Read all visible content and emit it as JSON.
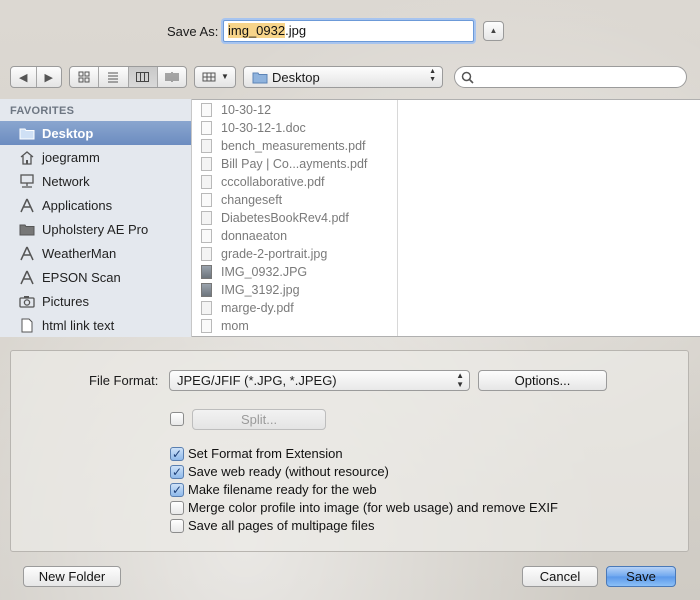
{
  "save_as": {
    "label": "Save As:",
    "filename_base": "img_0932",
    "filename_ext": ".jpg"
  },
  "toolbar": {
    "location": "Desktop",
    "search_placeholder": ""
  },
  "sidebar": {
    "header": "FAVORITES",
    "items": [
      {
        "label": "Desktop",
        "icon": "desktop-folder-icon",
        "selected": true
      },
      {
        "label": "joegramm",
        "icon": "home-icon"
      },
      {
        "label": "Network",
        "icon": "network-icon"
      },
      {
        "label": "Applications",
        "icon": "applications-icon"
      },
      {
        "label": "Upholstery AE Pro",
        "icon": "folder-icon"
      },
      {
        "label": "WeatherMan",
        "icon": "applications-icon"
      },
      {
        "label": "EPSON Scan",
        "icon": "applications-icon"
      },
      {
        "label": "Pictures",
        "icon": "camera-icon"
      },
      {
        "label": "html link text",
        "icon": "document-icon"
      }
    ]
  },
  "files": [
    {
      "name": "10-30-12",
      "type": "doc"
    },
    {
      "name": "10-30-12-1.doc",
      "type": "doc"
    },
    {
      "name": "bench_measurements.pdf",
      "type": "pdf"
    },
    {
      "name": "Bill Pay | Co...ayments.pdf",
      "type": "pdf"
    },
    {
      "name": "cccollaborative.pdf",
      "type": "pdf"
    },
    {
      "name": "changeseft",
      "type": "doc"
    },
    {
      "name": "DiabetesBookRev4.pdf",
      "type": "pdf"
    },
    {
      "name": "donnaeaton",
      "type": "doc"
    },
    {
      "name": "grade-2-portrait.jpg",
      "type": "pdf"
    },
    {
      "name": "IMG_0932.JPG",
      "type": "img"
    },
    {
      "name": "IMG_3192.jpg",
      "type": "img"
    },
    {
      "name": "marge-dy.pdf",
      "type": "pdf"
    },
    {
      "name": "mom",
      "type": "doc"
    }
  ],
  "options": {
    "file_format_label": "File Format:",
    "file_format_value": "JPEG/JFIF (*.JPG, *.JPEG)",
    "options_button": "Options...",
    "split_button": "Split...",
    "checkboxes": [
      {
        "label": "Set Format from Extension",
        "checked": true
      },
      {
        "label": "Save web ready (without resource)",
        "checked": true
      },
      {
        "label": "Make filename ready for the web",
        "checked": true
      },
      {
        "label": "Merge color profile into image (for web usage) and remove EXIF",
        "checked": false
      },
      {
        "label": "Save all pages of multipage files",
        "checked": false
      }
    ]
  },
  "footer": {
    "new_folder": "New Folder",
    "cancel": "Cancel",
    "save": "Save"
  },
  "colors": {
    "selection_blue": "#6c8cc0",
    "filename_highlight": "#f7d48a",
    "primary_button": "#5b98ea"
  }
}
